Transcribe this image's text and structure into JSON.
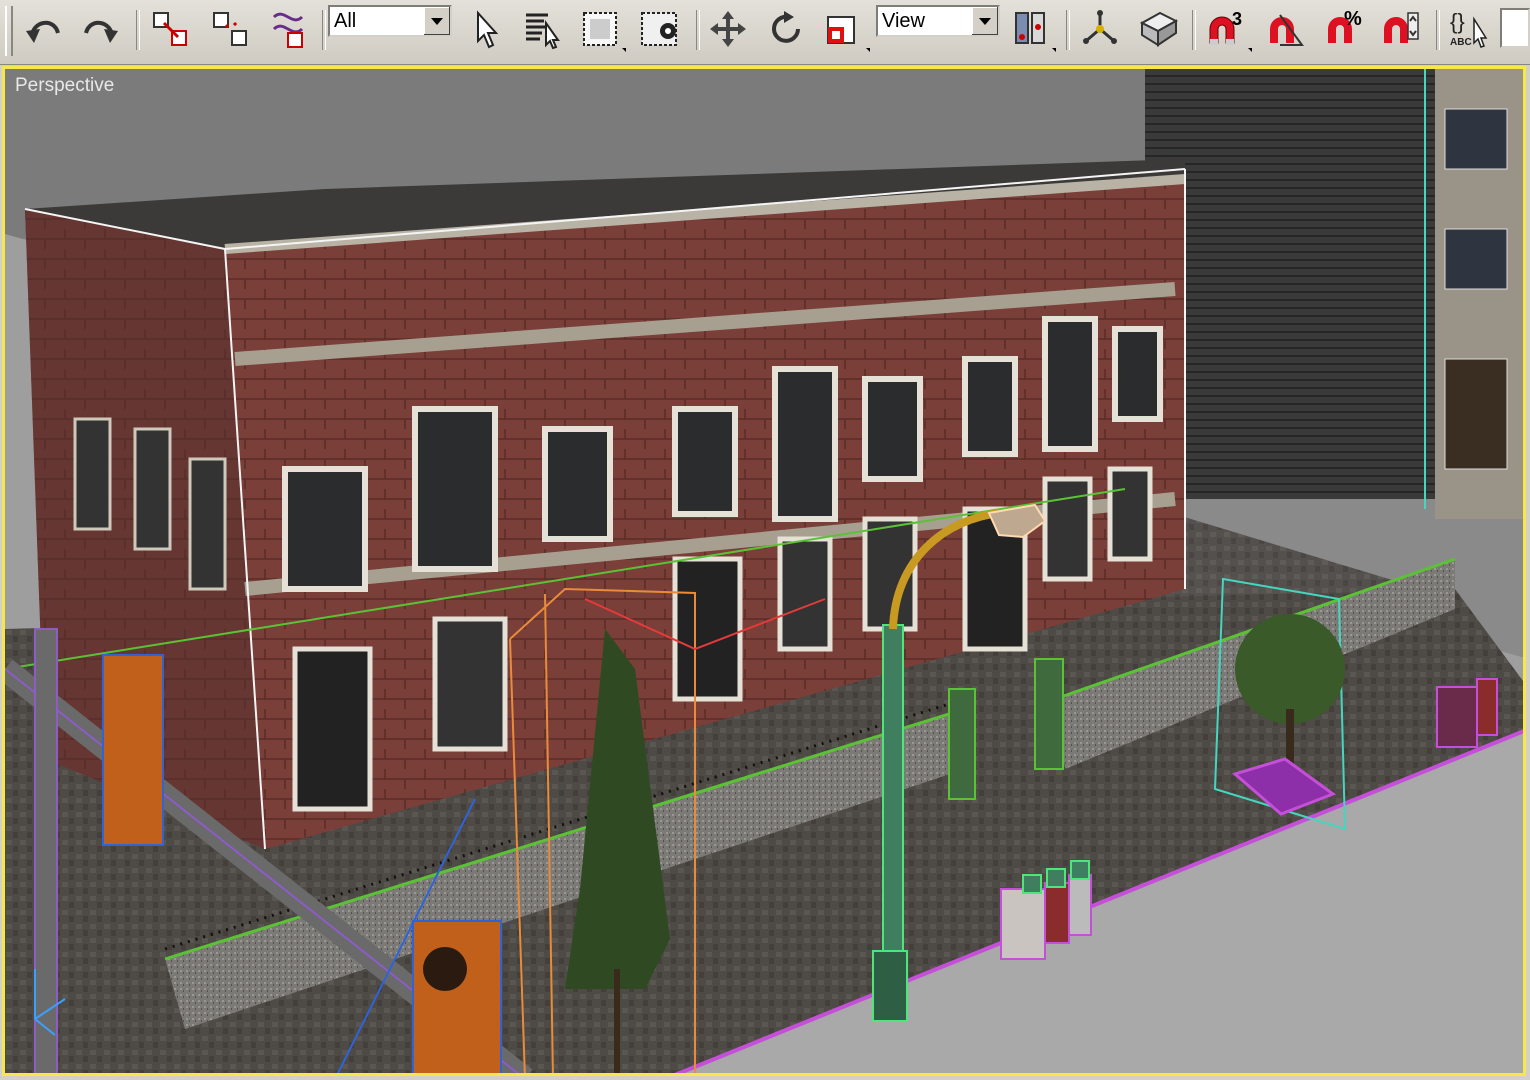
{
  "toolbar": {
    "selection_filter": "All",
    "reference_coord": "View",
    "icons": [
      "undo-icon",
      "redo-icon",
      "select-and-link-icon",
      "unlink-selection-icon",
      "bind-to-space-warp-icon",
      "selection-filter",
      "select-object-icon",
      "select-by-name-icon",
      "rectangular-selection-region-icon",
      "window-crossing-icon",
      "select-and-move-icon",
      "select-and-rotate-icon",
      "select-and-scale-icon",
      "reference-coordinate-system",
      "use-pivot-point-center-icon",
      "select-and-manipulate-icon",
      "keyboard-shortcut-override-icon",
      "snaps-toggle-icon",
      "angle-snap-toggle-icon",
      "percent-snap-toggle-icon",
      "spinner-snap-toggle-icon",
      "edit-named-selection-sets-icon"
    ],
    "snap_label": "3",
    "percent_label": "%",
    "named_sel_label": "ABC"
  },
  "viewport": {
    "label": "Perspective",
    "border_color": "#f5e84a"
  }
}
